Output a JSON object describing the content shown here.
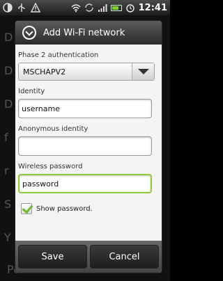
{
  "statusbar": {
    "icons": [
      "progress-icon",
      "usb-icon",
      "warning-icon",
      "wifi-icon",
      "sync-icon",
      "signal-icon",
      "battery-icon",
      "alarm-icon"
    ],
    "battery_level": 0.8,
    "time": "12:41"
  },
  "background": {
    "rows": [
      "D",
      "D",
      "D",
      "f",
      "r",
      "S",
      "Y",
      "Peew"
    ]
  },
  "dialog": {
    "title": "Add Wi-Fi network",
    "phase2_label": "Phase 2 authentication",
    "phase2_value": "MSCHAPV2",
    "identity_label": "Identity",
    "identity_value": "username",
    "anon_label": "Anonymous identity",
    "anon_value": "",
    "password_label": "Wireless password",
    "password_value": "password",
    "show_password_label": "Show password.",
    "show_password_checked": true,
    "save_label": "Save",
    "cancel_label": "Cancel",
    "accent_color": "#8fc93a"
  }
}
